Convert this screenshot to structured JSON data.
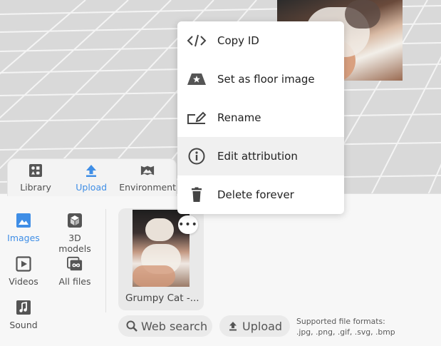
{
  "context_menu": {
    "items": [
      {
        "label": "Copy ID",
        "icon": "code-icon"
      },
      {
        "label": "Set as floor image",
        "icon": "floor-image-icon"
      },
      {
        "label": "Rename",
        "icon": "rename-icon"
      },
      {
        "label": "Edit attribution",
        "icon": "info-icon"
      },
      {
        "label": "Delete forever",
        "icon": "trash-icon"
      }
    ]
  },
  "tabs": [
    {
      "label": "Library",
      "icon": "library-icon"
    },
    {
      "label": "Upload",
      "icon": "upload-icon",
      "active": true
    },
    {
      "label": "Environment",
      "icon": "environment-icon"
    }
  ],
  "categories": [
    {
      "label": "Images",
      "icon": "image-icon",
      "active": true
    },
    {
      "label": "3D models",
      "icon": "cube-icon"
    },
    {
      "label": "Videos",
      "icon": "video-icon"
    },
    {
      "label": "All files",
      "icon": "infinity-icon"
    },
    {
      "label": "Sound",
      "icon": "music-icon"
    }
  ],
  "asset": {
    "label": "Grumpy Cat -...",
    "more": "•••"
  },
  "actions": {
    "web_search": "Web search",
    "upload": "Upload"
  },
  "formats": {
    "line1": "Supported file formats:",
    "line2": ".jpg, .png, .gif, .svg, .bmp"
  },
  "colors": {
    "accent": "#3f8ee6"
  }
}
